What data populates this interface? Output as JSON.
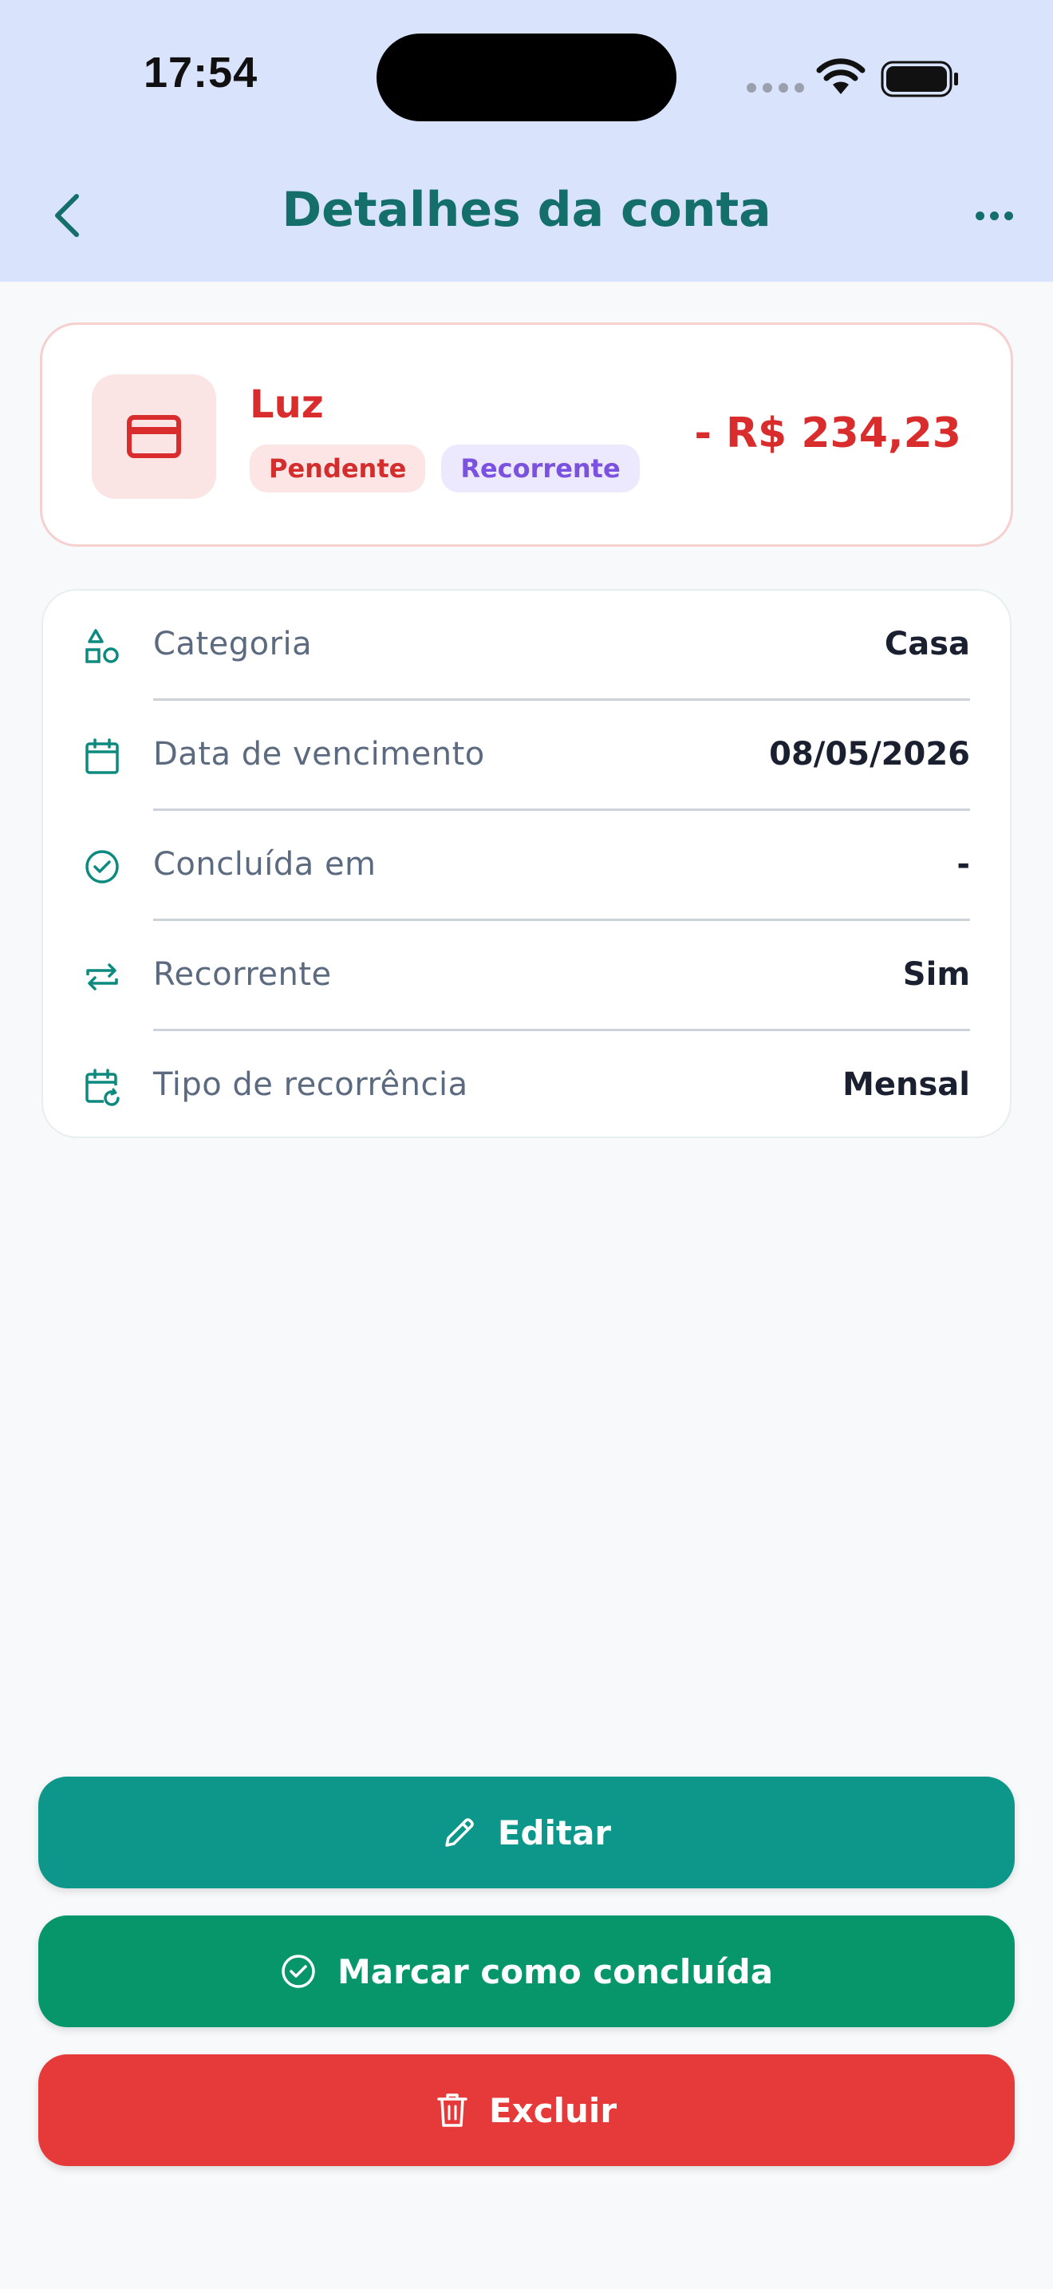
{
  "status_bar": {
    "time": "17:54"
  },
  "header": {
    "title": "Detalhes da conta",
    "back_icon": "chevron-left-icon",
    "more_icon": "more-horizontal-icon"
  },
  "summary": {
    "name": "Luz",
    "icon": "credit-card-icon",
    "badges": {
      "pending": "Pendente",
      "recurrent": "Recorrente"
    },
    "amount": "- R$ 234,23"
  },
  "details": [
    {
      "icon": "category-shapes-icon",
      "label": "Categoria",
      "value": "Casa"
    },
    {
      "icon": "calendar-icon",
      "label": "Data de vencimento",
      "value": "08/05/2026"
    },
    {
      "icon": "check-circle-icon",
      "label": "Concluída em",
      "value": "-"
    },
    {
      "icon": "repeat-icon",
      "label": "Recorrente",
      "value": "Sim"
    },
    {
      "icon": "calendar-repeat-icon",
      "label": "Tipo de recorrência",
      "value": "Mensal"
    }
  ],
  "actions": {
    "edit": "Editar",
    "mark_done": "Marcar como concluída",
    "delete": "Excluir"
  },
  "colors": {
    "header_bg": "#d9e3fc",
    "primary_teal": "#146e69",
    "danger": "#d92d2d",
    "edit_button": "#0d968a",
    "done_button": "#069669",
    "delete_button": "#e53a39"
  }
}
